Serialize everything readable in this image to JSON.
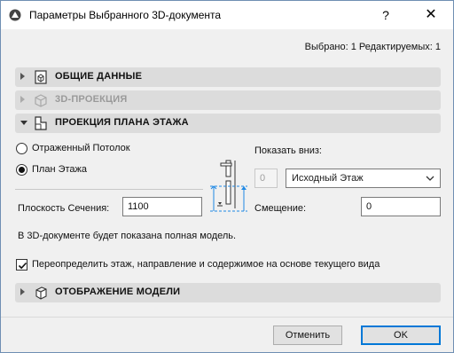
{
  "window": {
    "title": "Параметры Выбранного 3D-документа",
    "help_label": "?",
    "close_label": "✕"
  },
  "status": "Выбрано: 1 Редактируемых: 1",
  "sections": {
    "general": {
      "label": "ОБЩИЕ ДАННЫЕ",
      "icon": "document-3d-icon"
    },
    "projection3d": {
      "label": "3D-ПРОЕКЦИЯ",
      "icon": "box-3d-icon"
    },
    "floorplan": {
      "label": "ПРОЕКЦИЯ ПЛАНА ЭТАЖА",
      "icon": "floor-plan-icon"
    },
    "model_display": {
      "label": "ОТОБРАЖЕНИЕ МОДЕЛИ",
      "icon": "model-cube-icon"
    }
  },
  "floorplan": {
    "radio_ceiling": "Отраженный Потолок",
    "radio_plan": "План Этажа",
    "selected_radio": "radio_plan",
    "cut_plane_label": "Плоскость Сечения:",
    "cut_plane_value": "1100",
    "show_down_label": "Показать вниз:",
    "floor_number": "0",
    "floor_select": "Исходный Этаж",
    "offset_label": "Смещение:",
    "offset_value": "0",
    "note": "В 3D-документе будет показана полная модель."
  },
  "override": {
    "checked": true,
    "label": "Переопределить этаж, направление и содержимое на основе текущего вида"
  },
  "buttons": {
    "cancel": "Отменить",
    "ok": "OK"
  },
  "colors": {
    "accent": "#0078d7",
    "section_bg": "#dcdcdc",
    "dialog_bg": "#f0f0f0"
  }
}
